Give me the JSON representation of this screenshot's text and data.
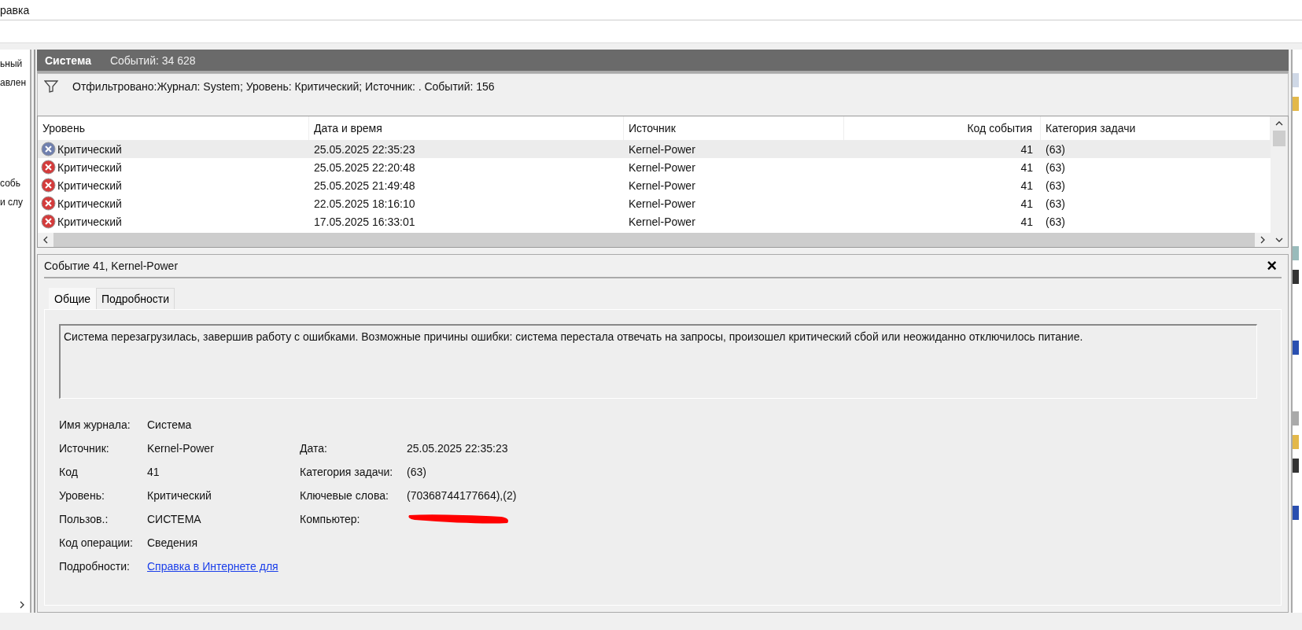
{
  "menu_bar": {
    "items": [
      "равка"
    ]
  },
  "left_pane": {
    "items": [
      "ьный",
      "авлен",
      "собь",
      "и слу"
    ]
  },
  "log_header": {
    "title": "Система",
    "count": "Событий: 34 628"
  },
  "filter": {
    "text": "Отфильтровано:Журнал: System; Уровень: Критический; Источник: . Событий: 156"
  },
  "table": {
    "columns": [
      "Уровень",
      "Дата и время",
      "Источник",
      "Код события",
      "Категория задачи"
    ],
    "rows": [
      {
        "level": "Критический",
        "datetime": "25.05.2025 22:35:23",
        "source": "Kernel-Power",
        "event_id": "41",
        "category": "(63)",
        "selected": true
      },
      {
        "level": "Критический",
        "datetime": "25.05.2025 22:20:48",
        "source": "Kernel-Power",
        "event_id": "41",
        "category": "(63)",
        "selected": false
      },
      {
        "level": "Критический",
        "datetime": "25.05.2025 21:49:48",
        "source": "Kernel-Power",
        "event_id": "41",
        "category": "(63)",
        "selected": false
      },
      {
        "level": "Критический",
        "datetime": "22.05.2025 18:16:10",
        "source": "Kernel-Power",
        "event_id": "41",
        "category": "(63)",
        "selected": false
      },
      {
        "level": "Критический",
        "datetime": "17.05.2025 16:33:01",
        "source": "Kernel-Power",
        "event_id": "41",
        "category": "(63)",
        "selected": false
      }
    ]
  },
  "details": {
    "title": "Событие 41, Kernel-Power",
    "close": "×",
    "tabs": [
      {
        "label": "Общие",
        "selected": true
      },
      {
        "label": "Подробности",
        "selected": false
      }
    ],
    "description": "Система перезагрузилась, завершив работу с ошибками. Возможные причины ошибки: система перестала отвечать на запросы, произошел критический сбой или неожиданно отключилось питание.",
    "left_fields": [
      {
        "label": "Имя журнала:",
        "value": "Система"
      },
      {
        "label": "Источник:",
        "value": "Kernel-Power"
      },
      {
        "label": "Код",
        "value": "41"
      },
      {
        "label": "Уровень:",
        "value": "Критический"
      },
      {
        "label": "Пользов.:",
        "value": "СИСТЕМА"
      },
      {
        "label": "Код операции:",
        "value": "Сведения"
      },
      {
        "label": "Подробности:",
        "value": "Справка в Интернете для ",
        "kind": "link"
      }
    ],
    "right_fields": [
      {
        "label": "Дата:",
        "value": "25.05.2025 22:35:23"
      },
      {
        "label": "Категория задачи:",
        "value": "(63)"
      },
      {
        "label": "Ключевые слова:",
        "value": "(70368744177664),(2)"
      },
      {
        "label": "Компьютер:",
        "kind": "redacted"
      }
    ]
  }
}
